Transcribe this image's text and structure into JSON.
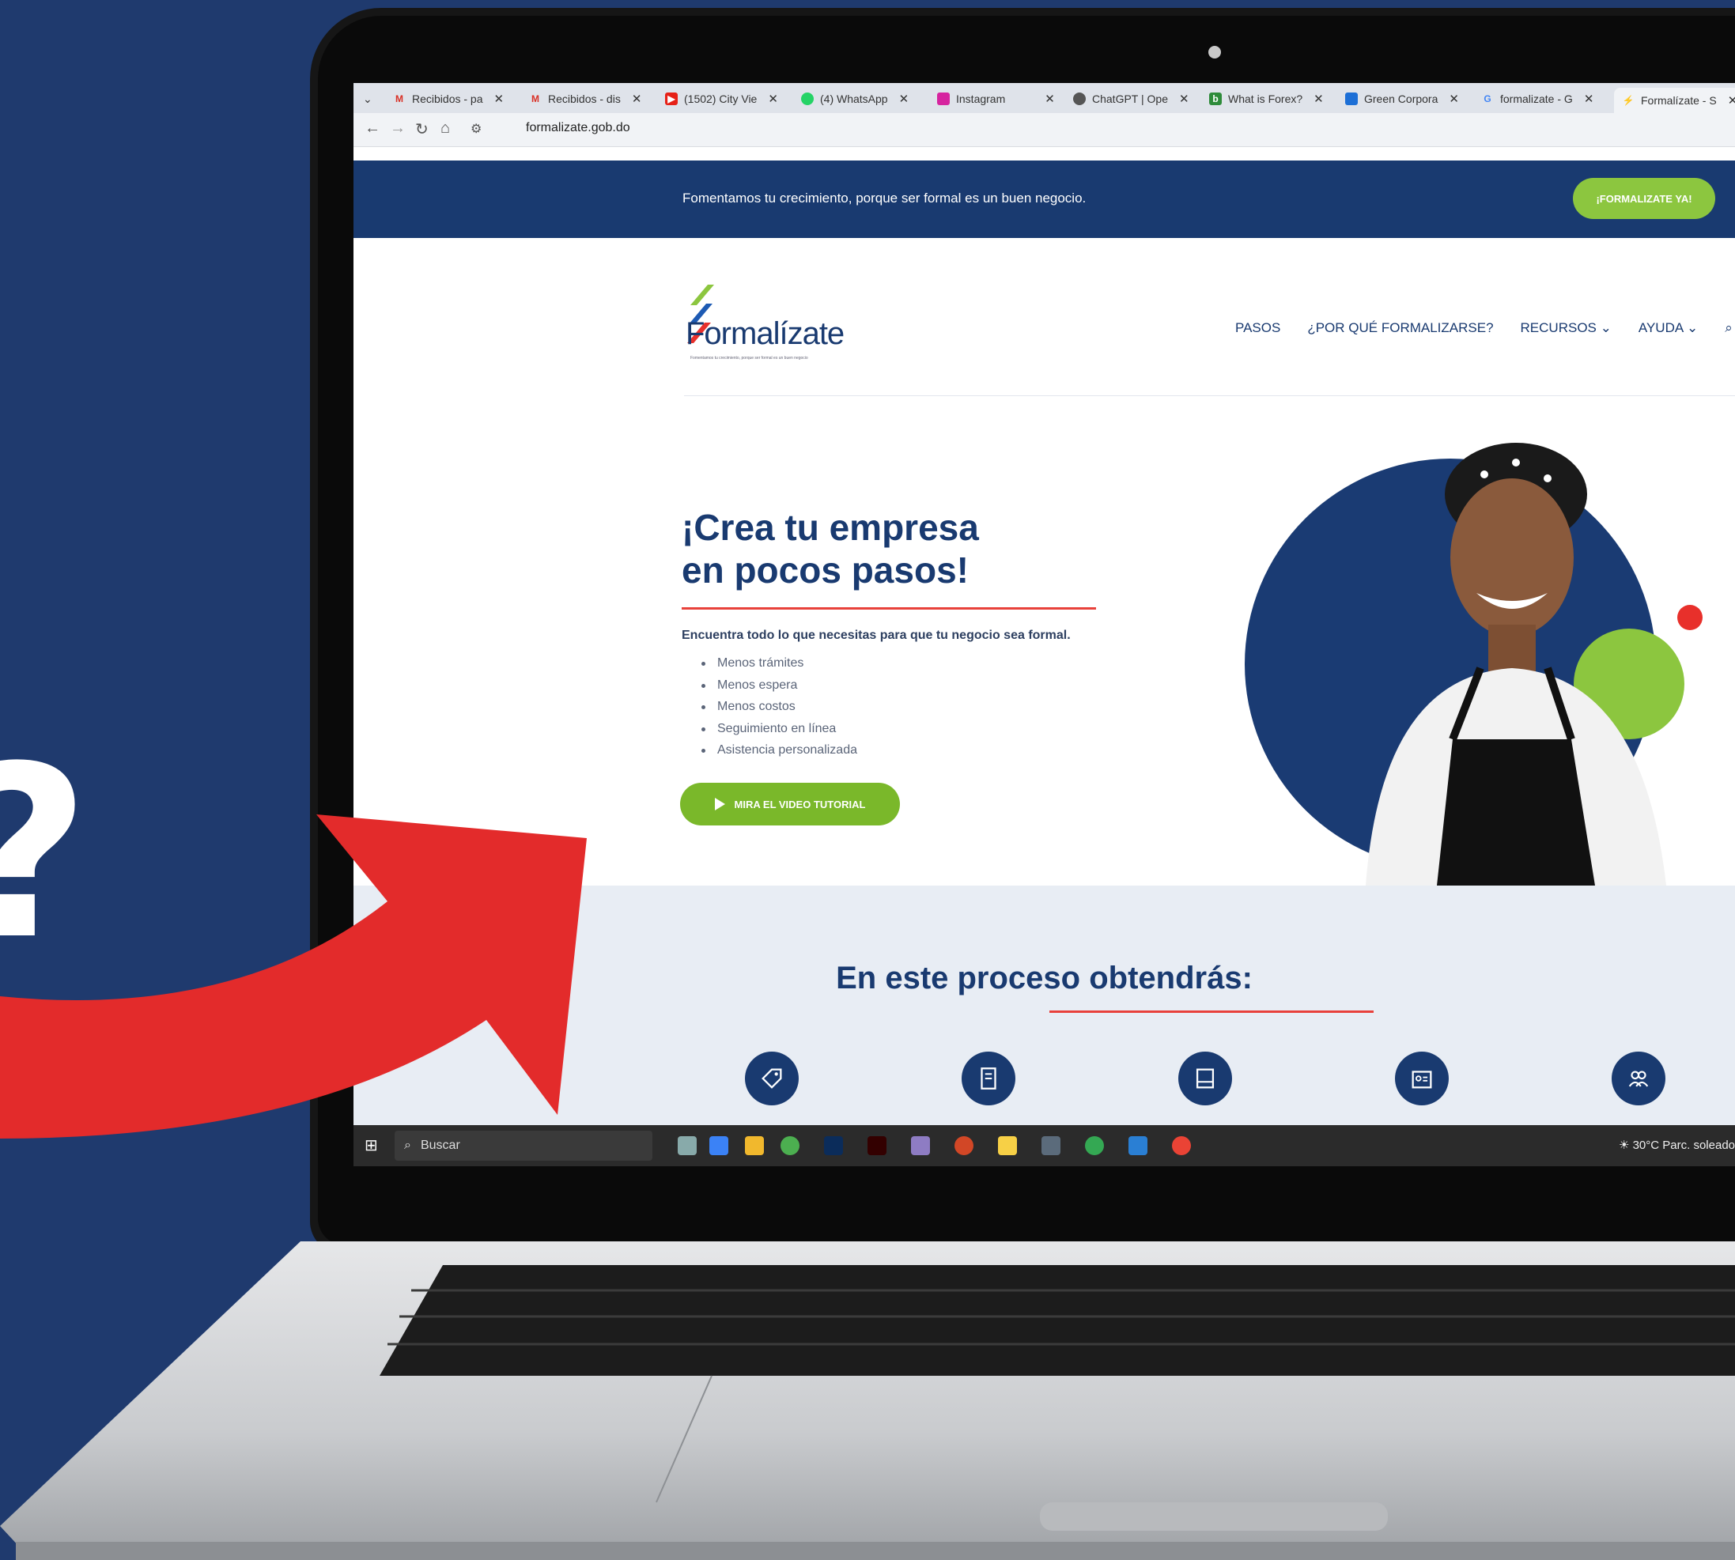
{
  "background": {
    "color": "#1f3a6e",
    "question_mark": "?"
  },
  "browser": {
    "tabs": [
      {
        "label": "Recibidos - pa",
        "icon": "gmail-icon"
      },
      {
        "label": "Recibidos - dis",
        "icon": "gmail-icon"
      },
      {
        "label": "(1502) City Vie",
        "icon": "youtube-icon"
      },
      {
        "label": "(4) WhatsApp",
        "icon": "whatsapp-icon"
      },
      {
        "label": "Instagram",
        "icon": "instagram-icon"
      },
      {
        "label": "ChatGPT | Ope",
        "icon": "chatgpt-icon"
      },
      {
        "label": "What is Forex?",
        "icon": "forex-icon"
      },
      {
        "label": "Green Corpora",
        "icon": "chat-icon"
      },
      {
        "label": "formalizate - G",
        "icon": "google-icon"
      },
      {
        "label": "Formalízate - S",
        "icon": "formalizate-icon"
      }
    ],
    "url": "formalizate.gob.do"
  },
  "site": {
    "topbar": {
      "text": "Fomentamos tu crecimiento, porque ser formal es un buen negocio.",
      "cta": "¡FORMALIZATE YA!"
    },
    "logo": {
      "text": "Formalízate",
      "tagline": "Fomentamos tu crecimiento, porque ser formal es un buen negocio"
    },
    "nav": [
      "PASOS",
      "¿POR QUÉ FORMALIZARSE?",
      "RECURSOS",
      "AYUDA"
    ],
    "hero": {
      "title_line1": "¡Crea tu empresa",
      "title_line2": "en pocos pasos!",
      "subtitle": "Encuentra todo lo que necesitas para que tu negocio sea formal.",
      "bullets": [
        "Menos trámites",
        "Menos espera",
        "Menos costos",
        "Seguimiento en línea",
        "Asistencia personalizada"
      ],
      "video_button": "MIRA EL VIDEO TUTORIAL"
    },
    "process": {
      "title": "En este proceso obtendrás:",
      "icons": [
        "tag-icon",
        "document-icon",
        "book-icon",
        "id-card-icon",
        "users-icon"
      ]
    },
    "colors": {
      "brand_blue": "#193a70",
      "brand_green": "#8cc63f",
      "accent_red": "#e8413b"
    }
  },
  "taskbar": {
    "search_placeholder": "Buscar",
    "weather": "30°C  Parc. soleado"
  }
}
